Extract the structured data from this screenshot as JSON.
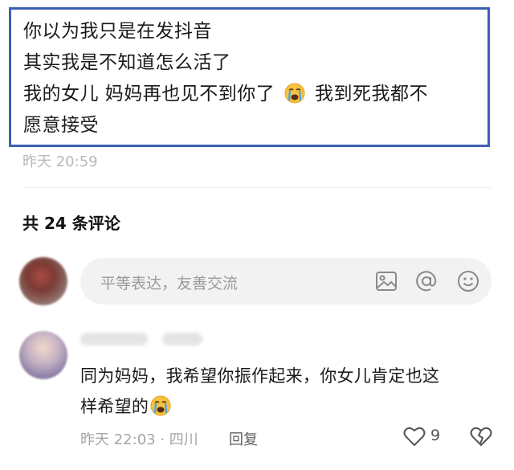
{
  "post": {
    "lines": [
      "你以为我只是在发抖音",
      "其实我是不知道怎么活了",
      "我的女儿  妈妈再也见不到你了",
      "我到死我都不",
      "愿意接受"
    ],
    "time": "昨天 20:59"
  },
  "comments_header": {
    "count_label": "共 24 条评论"
  },
  "input": {
    "placeholder": "平等表达，友善交流"
  },
  "comment": {
    "text_line1": "同为妈妈，我希望你振作起来，你女儿肯定也这",
    "text_line2": "样希望的",
    "meta": "昨天 22:03 · 四川",
    "reply_label": "回复",
    "like_count": "9"
  },
  "icons": [
    "image-icon",
    "at-icon",
    "emoji-icon",
    "heart-icon",
    "broken-heart-icon",
    "crying-emoji"
  ],
  "colors": {
    "post_border": "#3d5fb4",
    "secondary_text": "#a5a5a5",
    "input_bg": "#f2f2f2"
  }
}
